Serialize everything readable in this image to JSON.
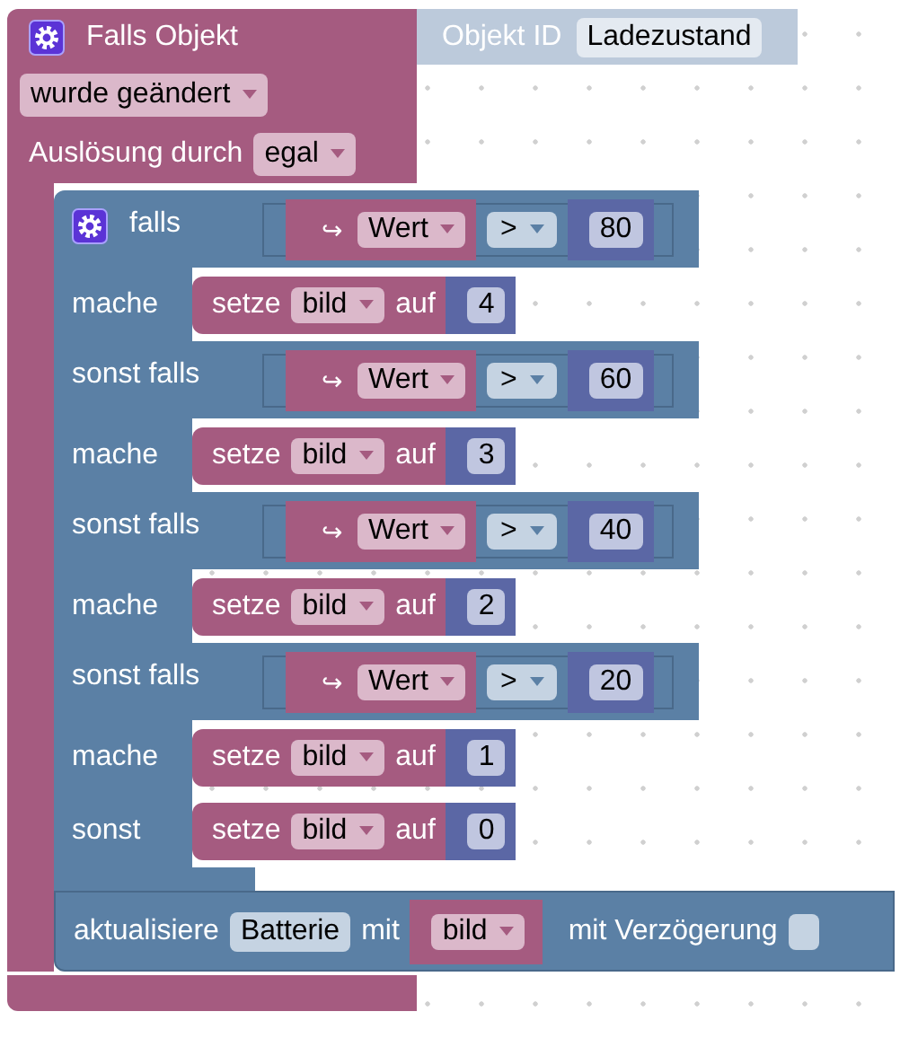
{
  "event": {
    "title": "Falls Objekt",
    "object_label": "Objekt ID",
    "object_id": "Ladezustand",
    "trigger": "wurde geändert",
    "source_label": "Auslösung durch",
    "source": "egal"
  },
  "if_block": {
    "branches": [
      {
        "label": "falls",
        "var_icon": "↪",
        "var": "Wert",
        "op": ">",
        "value": "80",
        "do_label": "mache",
        "set": {
          "verb": "setze",
          "var": "bild",
          "to": "auf",
          "value": "4"
        }
      },
      {
        "label": "sonst falls",
        "var_icon": "↪",
        "var": "Wert",
        "op": ">",
        "value": "60",
        "do_label": "mache",
        "set": {
          "verb": "setze",
          "var": "bild",
          "to": "auf",
          "value": "3"
        }
      },
      {
        "label": "sonst falls",
        "var_icon": "↪",
        "var": "Wert",
        "op": ">",
        "value": "40",
        "do_label": "mache",
        "set": {
          "verb": "setze",
          "var": "bild",
          "to": "auf",
          "value": "2"
        }
      },
      {
        "label": "sonst falls",
        "var_icon": "↪",
        "var": "Wert",
        "op": ">",
        "value": "20",
        "do_label": "mache",
        "set": {
          "verb": "setze",
          "var": "bild",
          "to": "auf",
          "value": "1"
        }
      }
    ],
    "else": {
      "label": "sonst",
      "set": {
        "verb": "setze",
        "var": "bild",
        "to": "auf",
        "value": "0"
      }
    }
  },
  "update": {
    "label": "aktualisiere",
    "target": "Batterie",
    "with": "mit",
    "var": "bild",
    "delay_label": "mit Verzögerung",
    "delay_checked": false
  }
}
